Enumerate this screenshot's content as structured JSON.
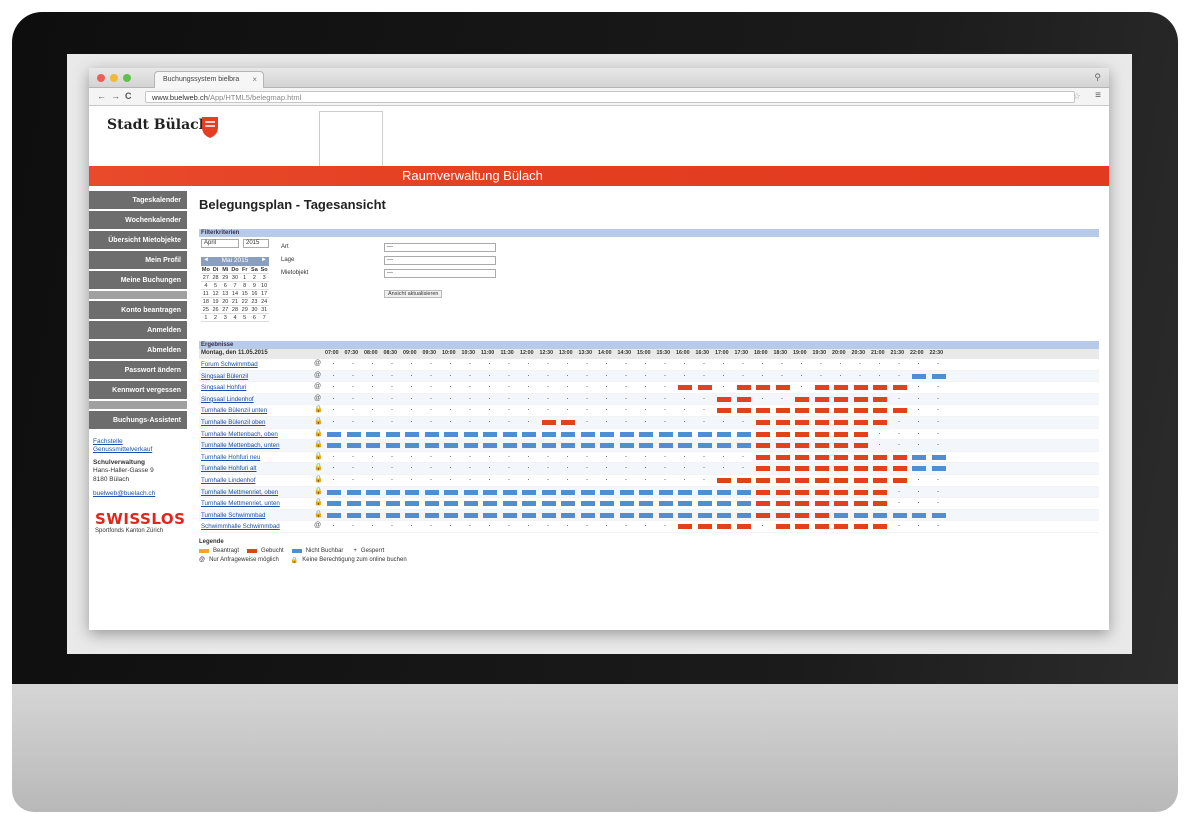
{
  "browser": {
    "tab_title": "Buchungssystem bielbra",
    "tab_close": "×",
    "url_host": "www.buelweb.ch",
    "url_path": "/App/HTML5/belegmap.html",
    "back": "←",
    "forward": "→",
    "reload": "C"
  },
  "site": {
    "brand": "Stadt Bülach",
    "band_title": "Raumverwaltung Bülach"
  },
  "sidebar": {
    "items": [
      "Tageskalender",
      "Wochenkalender",
      "Übersicht Mietobjekte",
      "Mein Profil",
      "Meine Buchungen"
    ],
    "items2": [
      "Konto beantragen",
      "Anmelden",
      "Abmelden",
      "Passwort ändern",
      "Kennwort vergessen"
    ],
    "items3": [
      "Buchungs-Assistent"
    ],
    "contact_link": "Fachstelle Genussmittelverkauf",
    "org_name": "Schulverwaltung",
    "address_1": "Hans-Haller-Gasse 9",
    "address_2": "8180 Bülach",
    "email": "buelweb@buelach.ch",
    "lottery": "SWISSLOS",
    "lottery_sub": "Sportfonds Kanton Zürich"
  },
  "main": {
    "title": "Belegungsplan - Tagesansicht",
    "filter_section": "Filterkriterien",
    "month_select": "April",
    "year_select": "2015",
    "calendar": {
      "month": "Mai 2015",
      "prev": "◄",
      "next": "►",
      "dow": [
        "Mo",
        "Di",
        "Mi",
        "Do",
        "Fr",
        "Sa",
        "So"
      ],
      "days": [
        "27",
        "28",
        "29",
        "30",
        "1",
        "2",
        "3",
        "4",
        "5",
        "6",
        "7",
        "8",
        "9",
        "10",
        "11",
        "12",
        "13",
        "14",
        "15",
        "16",
        "17",
        "18",
        "19",
        "20",
        "21",
        "22",
        "23",
        "24",
        "25",
        "26",
        "27",
        "28",
        "29",
        "30",
        "31",
        "1",
        "2",
        "3",
        "4",
        "5",
        "6",
        "7"
      ]
    },
    "filter_labels": [
      "Art",
      "Lage",
      "Mietobjekt"
    ],
    "filter_values": [
      "---",
      "---",
      "---"
    ],
    "apply_button": "Ansicht aktualisieren",
    "results_section": "Ergebnisse",
    "date_label": "Montag, den 11.05.2015",
    "times": [
      "07:00",
      "07:30",
      "08:00",
      "08:30",
      "09:00",
      "09:30",
      "10:00",
      "10:30",
      "11:00",
      "11:30",
      "12:00",
      "12:30",
      "13:00",
      "13:30",
      "14:00",
      "14:30",
      "15:00",
      "15:30",
      "16:00",
      "16:30",
      "17:00",
      "17:30",
      "18:00",
      "18:30",
      "19:00",
      "19:30",
      "20:00",
      "20:30",
      "21:00",
      "21:30",
      "22:00",
      "22:30"
    ],
    "rooms": [
      {
        "name": "Forum Schwimmbad",
        "icon": "@",
        "slots": "ffffffffffffffffffffffffffffffff"
      },
      {
        "name": "Singsaal Bülenzil",
        "icon": "@",
        "slots": "ffffffffffffffffffffffffffffffbb"
      },
      {
        "name": "Singsaal Hohfuri",
        "icon": "@",
        "slots": "ffffffffffffffffffrrfrrrfrrrrrff"
      },
      {
        "name": "Singsaal Lindenhof",
        "icon": "@",
        "slots": "ffffffffffffffffffffrrffrrrrrfff"
      },
      {
        "name": "Turnhalle Bülenzil unten",
        "icon": "L",
        "slots": "ffffffffffffffffffffrrrrrrrrrrff"
      },
      {
        "name": "Turnhalle Bülenzil oben",
        "icon": "L",
        "slots": "fffffffffffrrfffffffffrrrrrrrfff"
      },
      {
        "name": "Turnhalle Mettenbach, oben",
        "icon": "L",
        "slots": "bbbbbbbbbbbbbbbbbbbbbbrrrrrrffff"
      },
      {
        "name": "Turnhalle Mettenbach, unten",
        "icon": "L",
        "slots": "bbbbbbbbbbbbbbbbbbbbbbrrrrrrffff"
      },
      {
        "name": "Turnhalle Hohfuri neu",
        "icon": "L",
        "slots": "ffffffffffffffffffffffrrrrrrrrbb"
      },
      {
        "name": "Turnhalle Hohfuri alt",
        "icon": "L",
        "slots": "ffffffffffffffffffffffrrrrrrrrbb"
      },
      {
        "name": "Turnhalle Lindenhof",
        "icon": "L",
        "slots": "ffffffffffffffffffffrrrrrrrrrrff"
      },
      {
        "name": "Turnhalle Mettmenriet, oben",
        "icon": "L",
        "slots": "bbbbbbbbbbbbbbbbbbbbbbrrrrrrrfff"
      },
      {
        "name": "Turnhalle Mettmenriet, unten",
        "icon": "L",
        "slots": "bbbbbbbbbbbbbbbbbbbbbbrrrrrrrfff"
      },
      {
        "name": "Turnhalle Schwimmbad",
        "icon": "L",
        "slots": "bbbbbbbbbbbbbbbbbbbbbbrrrrbbbbbb"
      },
      {
        "name": "Schwimmhalle Schwimmbad",
        "icon": "@",
        "slots": "ffffffffffffffffffrrrrfrrrrrrfff"
      }
    ],
    "legend": {
      "title": "Legende",
      "requested": "Beantragt",
      "booked": "Gebucht",
      "unavailable": "Nicht Buchbar",
      "free_marker": "+",
      "free": "Gesperrt",
      "icon_at_note": "Nur Anfrageweise möglich",
      "icon_lock_note": "Keine Berechtigung zum online buchen"
    },
    "colors": {
      "requested": "#f2a81d",
      "booked": "#e0421e",
      "unavailable": "#4f8fd1",
      "header_red": "#e43f22",
      "sidebar": "#6d6d6d",
      "section_bar": "#b7cbe8"
    }
  }
}
